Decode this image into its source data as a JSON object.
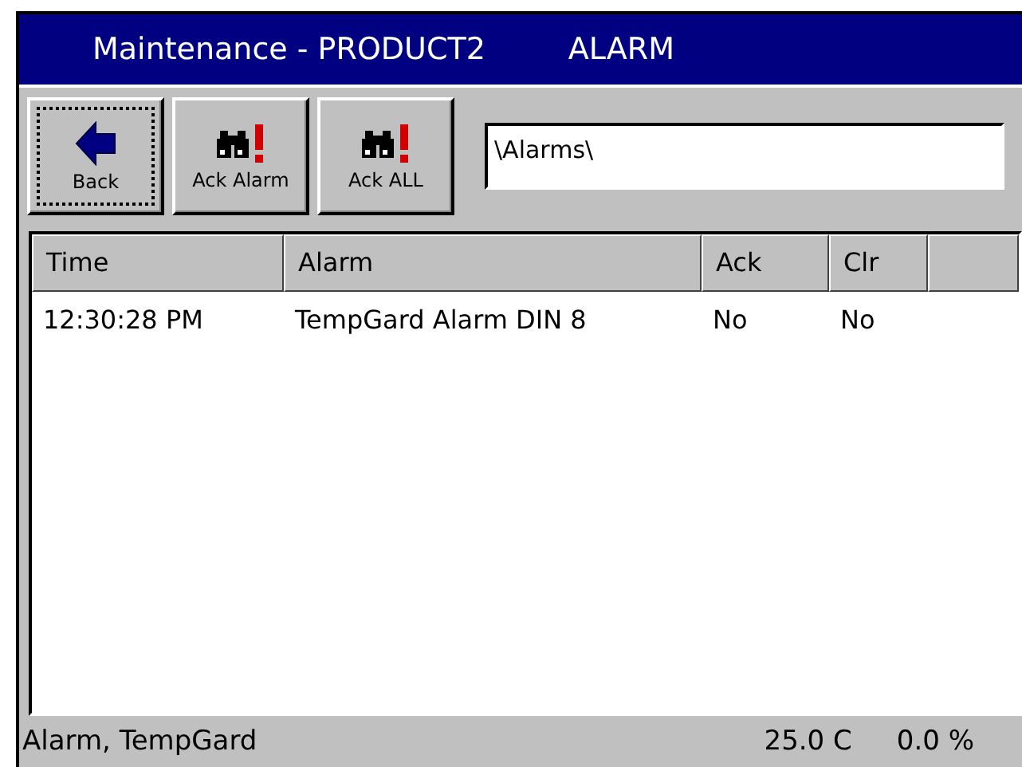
{
  "window": {
    "title": "Maintenance - PRODUCT2",
    "mode": "ALARM"
  },
  "toolbar": {
    "buttons": [
      {
        "label": "Back",
        "kind": "back",
        "focused": true
      },
      {
        "label": "Ack Alarm",
        "kind": "ack",
        "focused": false
      },
      {
        "label": "Ack ALL",
        "kind": "ack",
        "focused": false
      }
    ],
    "path": "\\Alarms\\"
  },
  "table": {
    "columns": [
      "Time",
      "Alarm",
      "Ack",
      "Clr"
    ],
    "rows": [
      [
        "12:30:28 PM",
        "TempGard Alarm DIN 8",
        "No",
        "No"
      ]
    ]
  },
  "status_bar": {
    "message": "Alarm, TempGard",
    "temperature": "25.0 C",
    "percent": "0.0 %"
  }
}
